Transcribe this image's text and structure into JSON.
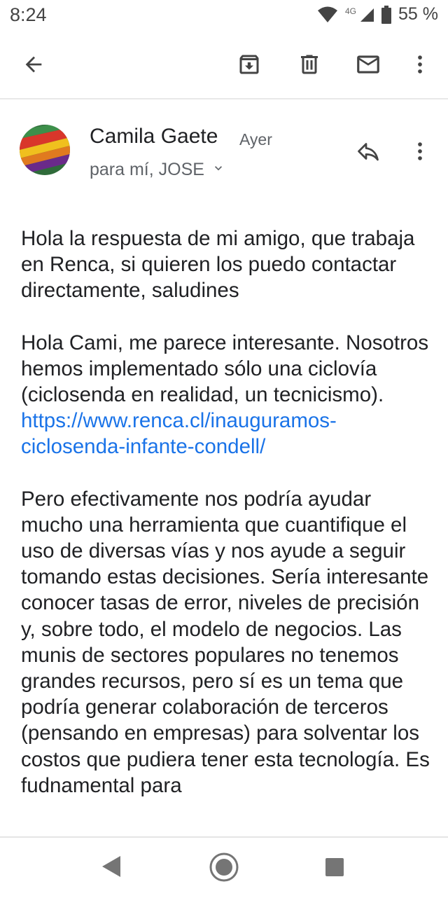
{
  "status_bar": {
    "time": "8:24",
    "network": "4G",
    "battery": "55 %",
    "icons": [
      "wifi-icon",
      "cell-signal-icon",
      "battery-icon"
    ]
  },
  "toolbar": {
    "icons": [
      "back-arrow-icon",
      "archive-icon",
      "delete-icon",
      "mark-unread-icon",
      "more-vert-icon"
    ]
  },
  "email": {
    "sender_name": "Camila Gaete",
    "time": "Ayer",
    "recipients": "para mí, JOSE",
    "paragraphs": [
      {
        "text": "Hola la respuesta de mi amigo, que trabaja en Renca, si quieren los puedo contactar directamente, saludines"
      },
      {
        "text": "Hola Cami, me parece interesante. Nosotros hemos implementado  sólo una ciclovía (ciclosenda en realidad, un tecnicismo). ",
        "link": "https://www.renca.cl/inauguramos-ciclosenda-infante-condell/"
      },
      {
        "text": "Pero efectivamente nos podría ayudar mucho una herramienta que cuantifique el uso de diversas vías y nos ayude a seguir tomando estas decisiones. Sería interesante conocer tasas de error, niveles de precisión y, sobre todo, el modelo de negocios. Las munis de sectores populares no tenemos grandes recursos, pero sí es un tema que podría generar colaboración de terceros (pensando en empresas) para solventar los costos que pudiera tener esta tecnología. Es fudnamental para"
      }
    ]
  },
  "colors": {
    "link": "#1a73e8",
    "text": "#202124",
    "secondary": "#5f6368"
  }
}
